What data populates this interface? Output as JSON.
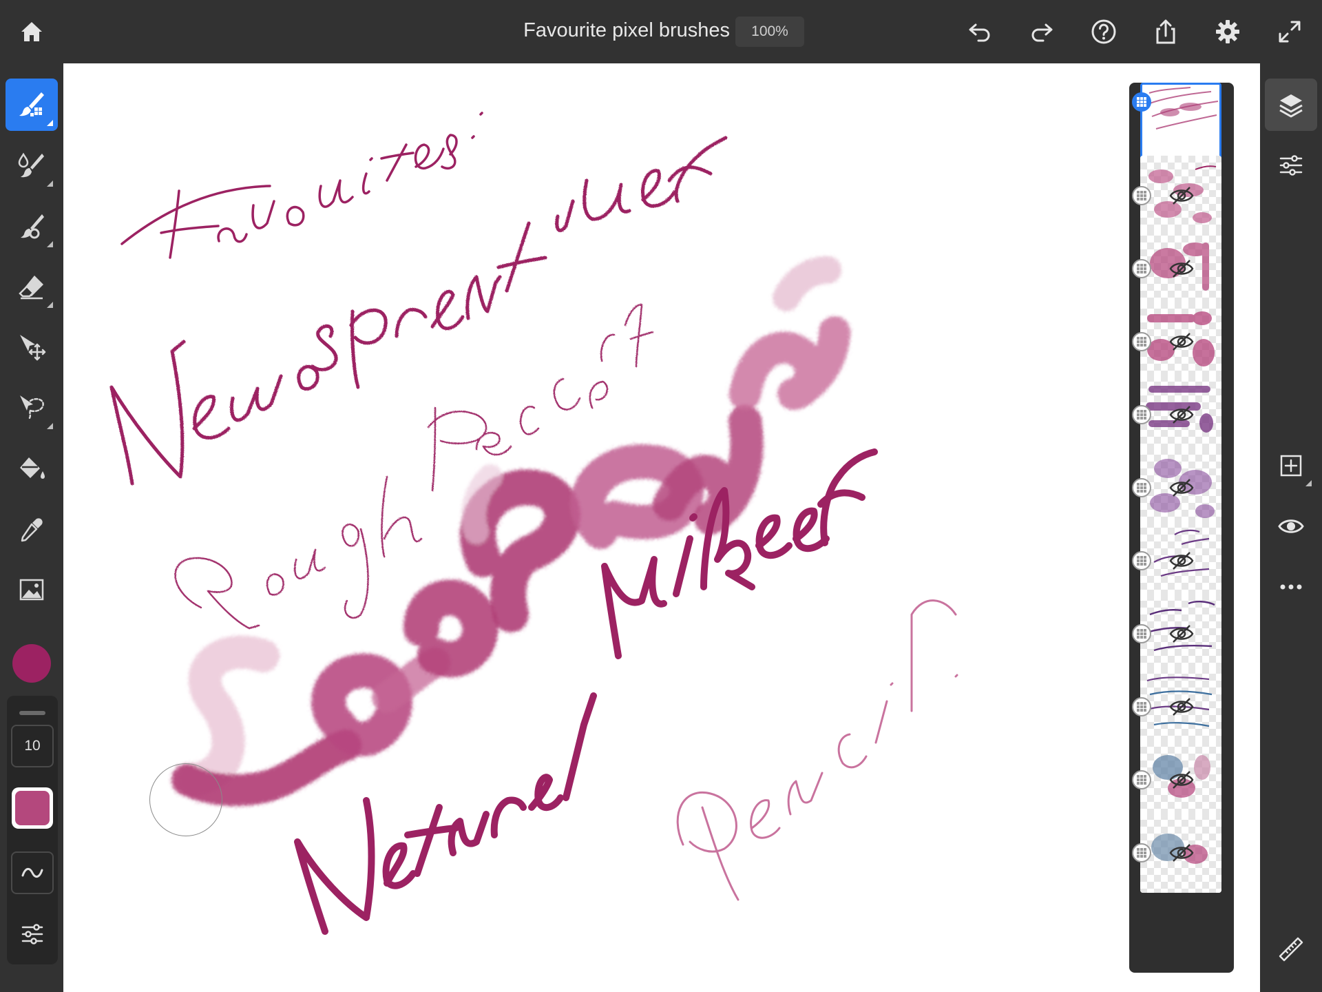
{
  "app": {
    "document_title": "Favourite pixel brushes",
    "zoom": "100%"
  },
  "topbar": {
    "icons": [
      "home-icon",
      "undo-icon",
      "redo-icon",
      "help-icon",
      "share-icon",
      "settings-icon",
      "fullscreen-icon"
    ]
  },
  "left_toolbar": {
    "tools": [
      "pixel-brush",
      "live-brush",
      "vector-brush",
      "eraser",
      "transform",
      "lasso-selection",
      "fill",
      "eyedropper",
      "place-image"
    ],
    "active_tool": "pixel-brush",
    "color": "#9c2262",
    "brush_size": "10",
    "brush_color": "#b4487d"
  },
  "canvas": {
    "handwritten_text": [
      "Favourites:",
      "Newsprint Inker",
      "Rough Pencil",
      "Soft Round",
      "Natural Inker",
      "Pencil."
    ],
    "ink_color": "#9c2262",
    "light_ink_color": "#c05b8d"
  },
  "layers": {
    "count": 10,
    "selected_index": 0,
    "hidden_indexes": [
      1,
      2,
      3,
      4,
      5,
      6,
      7,
      8,
      9
    ]
  },
  "right_toolbar": {
    "icons": [
      "layers-icon",
      "layer-properties-icon",
      "add-layer-icon",
      "visibility-icon",
      "more-icon",
      "ruler-icon"
    ]
  },
  "colors": {
    "accent": "#2a7cf0",
    "chrome": "#323232",
    "panel": "#262626"
  }
}
